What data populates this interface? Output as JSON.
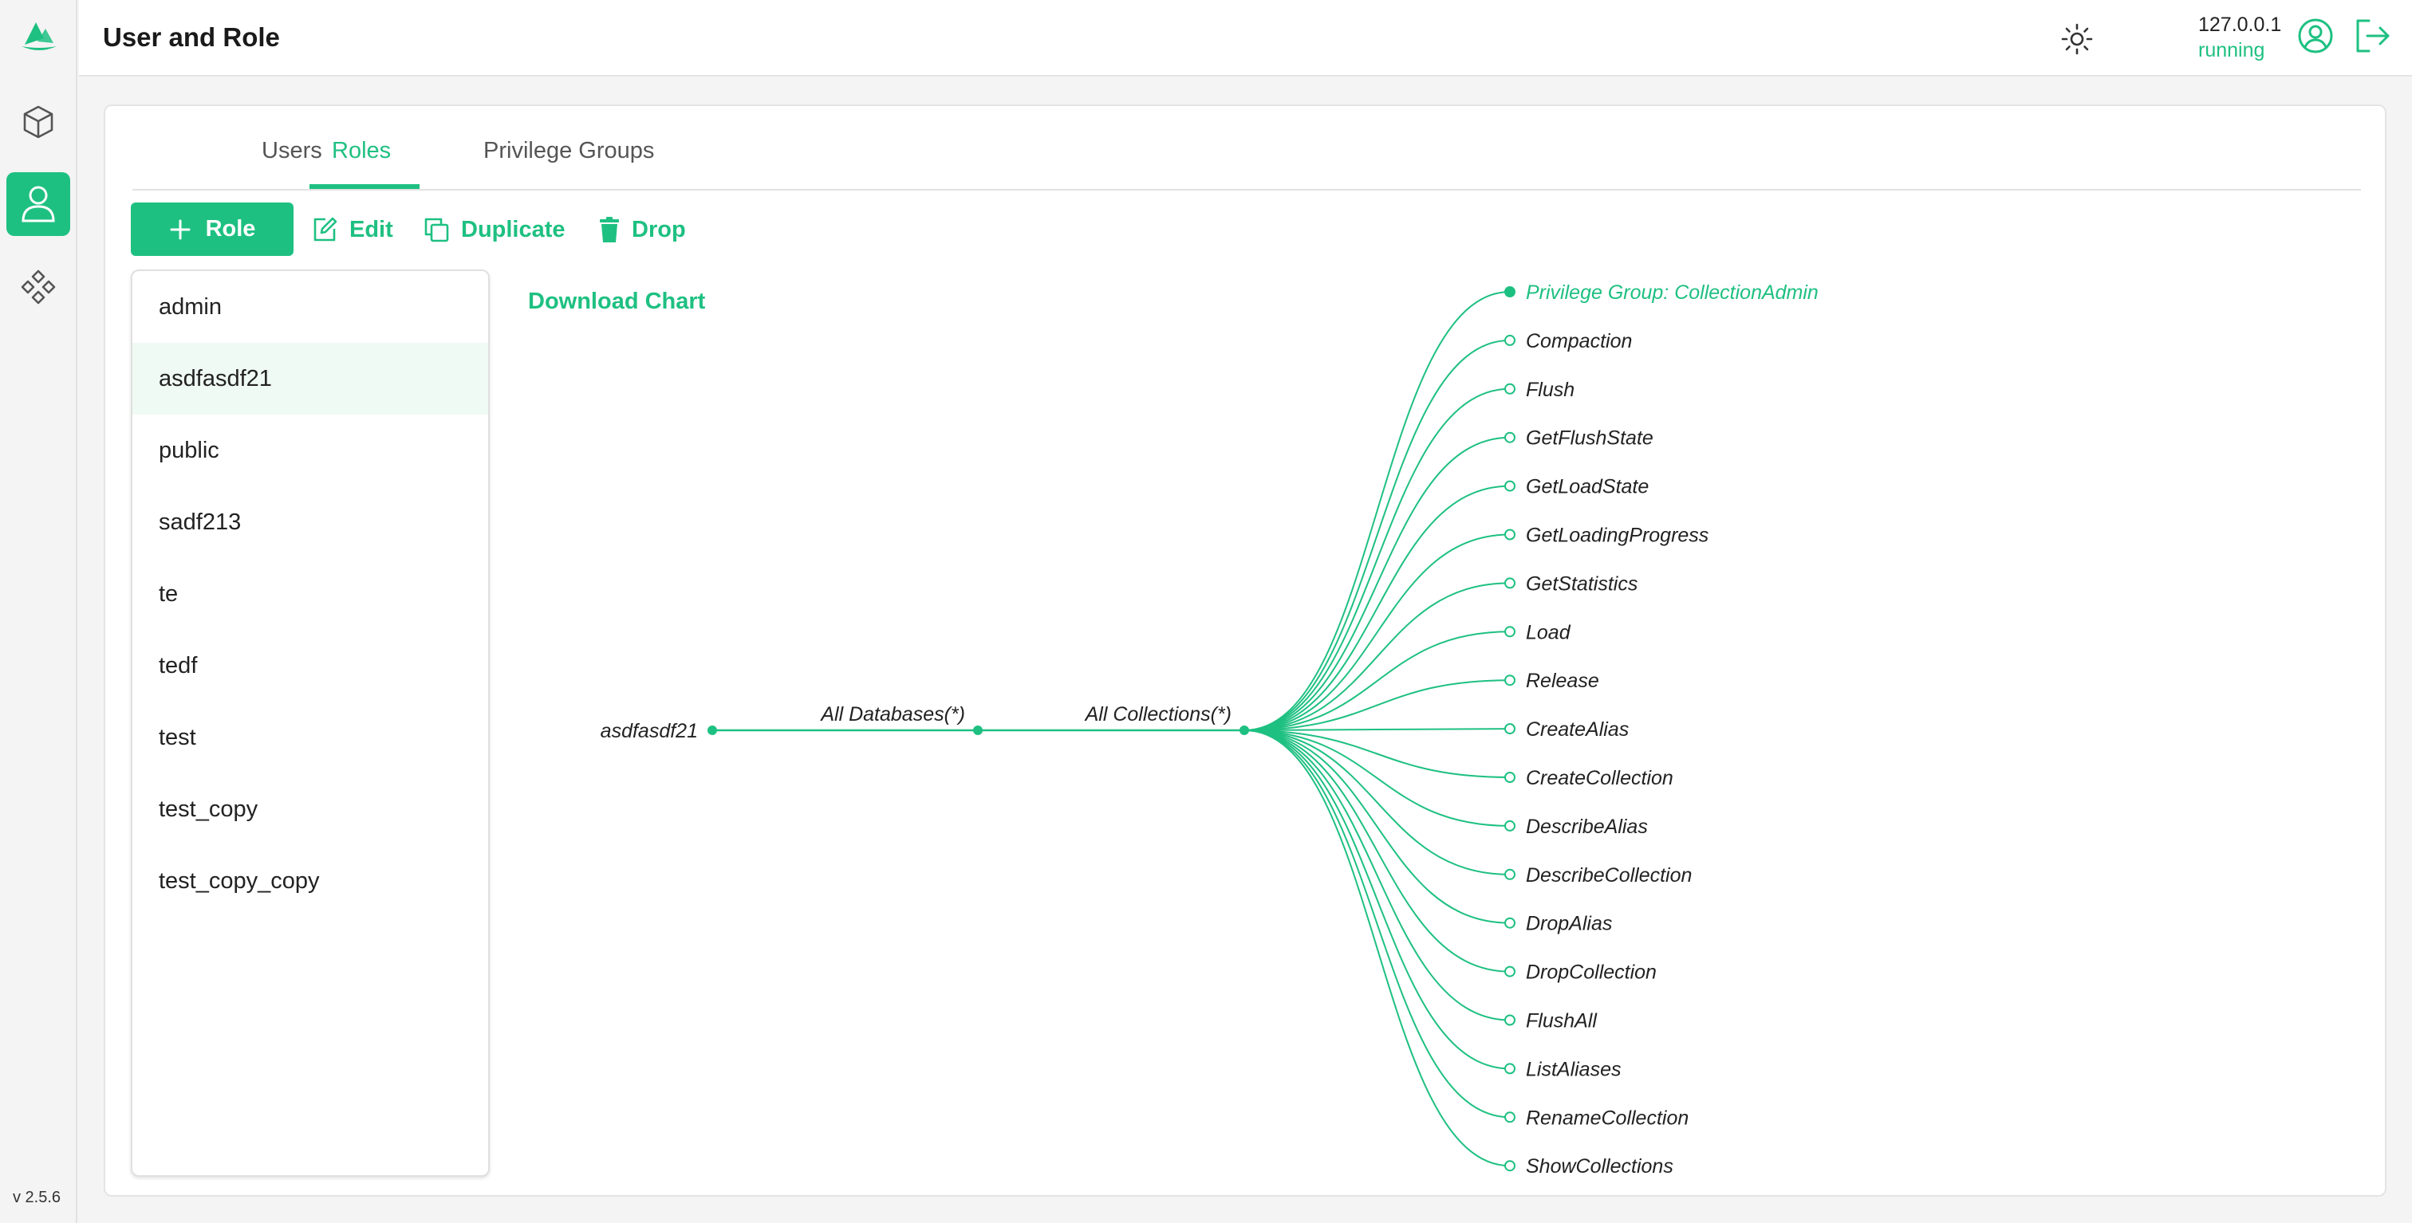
{
  "app": {
    "title": "User and Role",
    "version": "v 2.5.6",
    "server_address": "127.0.0.1",
    "server_status": "running",
    "accent_color": "#1ec081"
  },
  "sidebar": {
    "items": [
      {
        "icon": "cube-icon",
        "active": false
      },
      {
        "icon": "user-icon",
        "active": true
      },
      {
        "icon": "diamond-grid-icon",
        "active": false
      }
    ]
  },
  "tabs": [
    {
      "label": "Users",
      "active": false
    },
    {
      "label": "Roles",
      "active": true
    },
    {
      "label": "Privilege Groups",
      "active": false
    }
  ],
  "toolbar": {
    "add_label": "Role",
    "edit_label": "Edit",
    "duplicate_label": "Duplicate",
    "drop_label": "Drop"
  },
  "roles": [
    "admin",
    "asdfasdf21",
    "public",
    "sadf213",
    "te",
    "tedf",
    "test",
    "test_copy",
    "test_copy_copy"
  ],
  "selected_role": "asdfasdf21",
  "chart": {
    "download_label": "Download Chart",
    "root": "asdfasdf21",
    "database_node": "All Databases(*)",
    "collection_node": "All Collections(*)",
    "privileges": [
      "Privilege Group: CollectionAdmin",
      "Compaction",
      "Flush",
      "GetFlushState",
      "GetLoadState",
      "GetLoadingProgress",
      "GetStatistics",
      "Load",
      "Release",
      "CreateAlias",
      "CreateCollection",
      "DescribeAlias",
      "DescribeCollection",
      "DropAlias",
      "DropCollection",
      "FlushAll",
      "ListAliases",
      "RenameCollection",
      "ShowCollections"
    ]
  }
}
